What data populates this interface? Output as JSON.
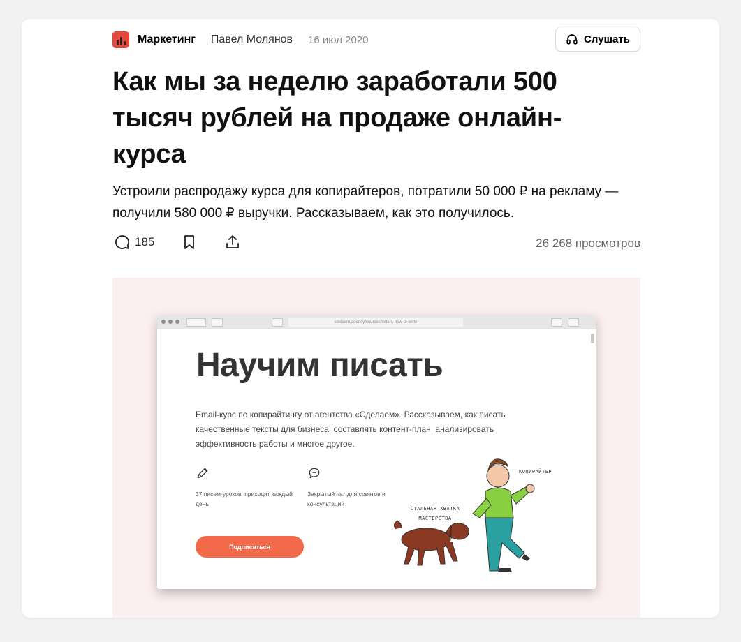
{
  "meta": {
    "rubric": "Маркетинг",
    "author": "Павел Молянов",
    "date": "16 июл 2020",
    "listen_label": "Слушать"
  },
  "article": {
    "title": "Как мы за неделю заработали 500 тысяч рублей на продаже онлайн-курса",
    "lead": "Устроили распродажу курса для копирайтеров, потратили 50 000 ₽ на рекламу — получили 580 000 ₽ выручки. Рассказываем, как это получилось."
  },
  "actions": {
    "comments_count": "185",
    "views": "26 268 просмотров"
  },
  "hero": {
    "url": "sdelaem.agency/courses/letters-how-to-write",
    "heading": "Научим писать",
    "text": "Email-курс по копирайтингу от агентства «Сделаем». Рассказываем, как писать качественные тексты для бизнеса, составлять контент-план, анализировать эффективность работы и многое другое.",
    "feature1": "37 писем-уроков, приходят каждый день",
    "feature2": "Закрытый чат для советов и консультаций",
    "button": "Подписаться",
    "caption_copywriter": "КОПИРАЙТЕР",
    "caption_grip": "СТАЛЬНАЯ ХВАТКА МАСТЕРСТВА"
  },
  "colors": {
    "rubric_icon": "#e5483a",
    "hero_bg": "#fcefef",
    "subscribe": "#f26a4a"
  }
}
